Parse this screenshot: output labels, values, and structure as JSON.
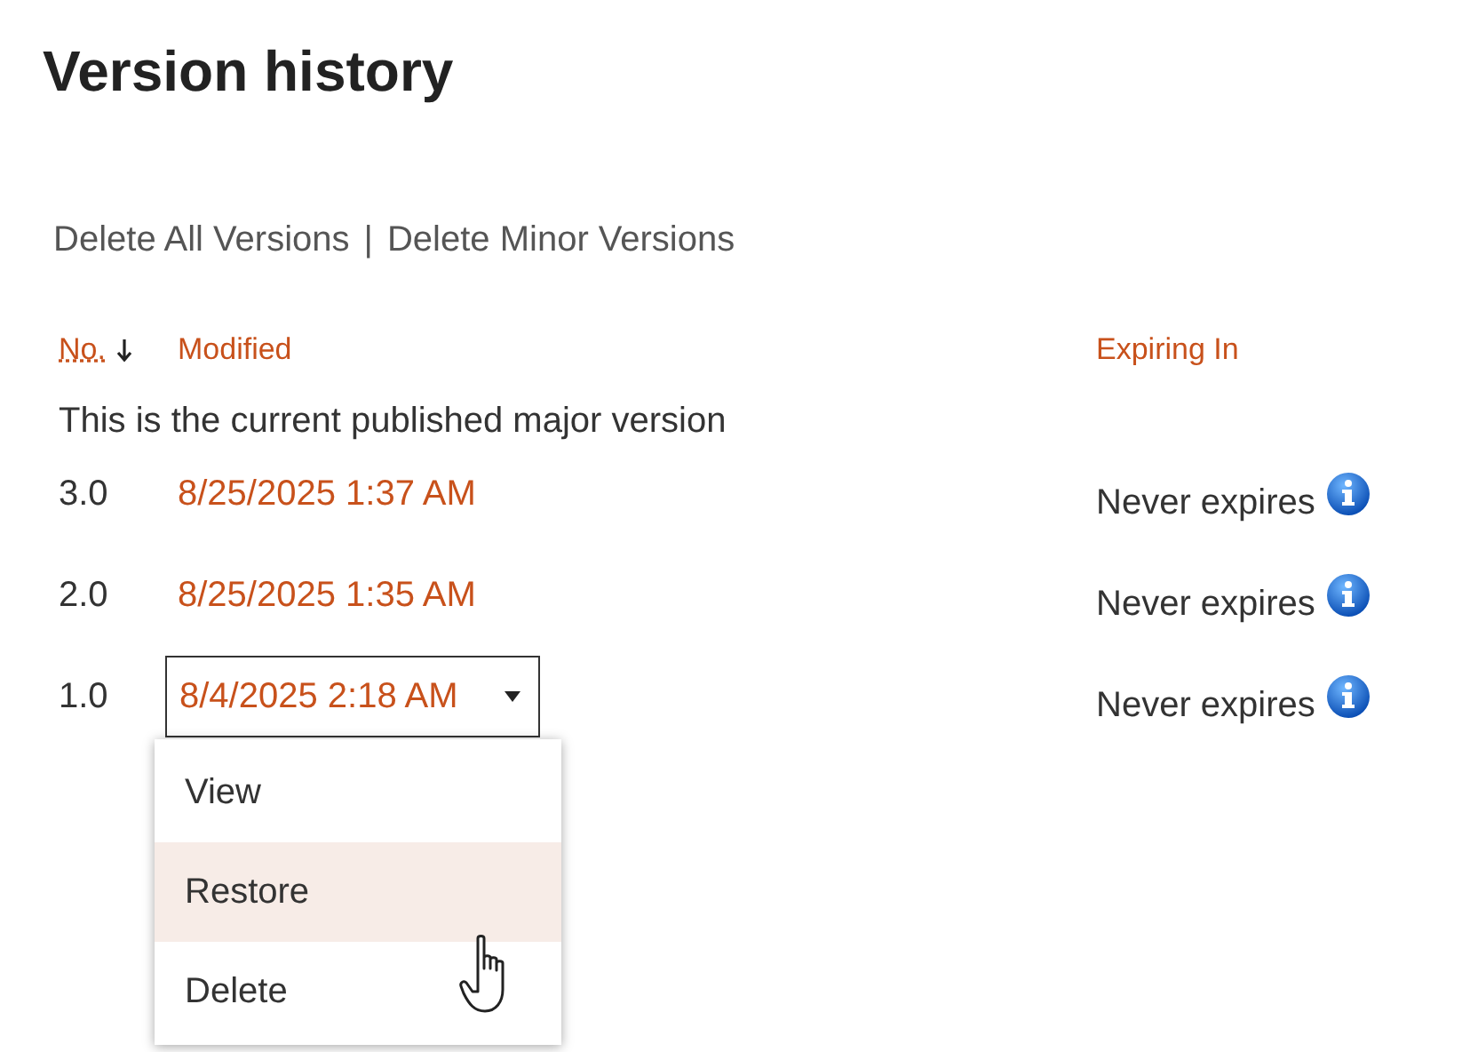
{
  "title": "Version history",
  "actions": [
    {
      "label": "Delete All Versions"
    },
    {
      "label": "Delete Minor Versions"
    }
  ],
  "action_separator": "|",
  "columns": [
    {
      "label": "No.",
      "sorted": true
    },
    {
      "label": "Modified",
      "sorted": false
    },
    {
      "label": "Expiring In",
      "sorted": false
    }
  ],
  "note": "This is the current published major version",
  "rows": [
    {
      "no": "3.0",
      "modified": "8/25/2025 1:37 AM",
      "expiring": "Never expires",
      "menu_open": false
    },
    {
      "no": "2.0",
      "modified": "8/25/2025 1:35 AM",
      "expiring": "Never expires",
      "menu_open": false
    },
    {
      "no": "1.0",
      "modified": "8/4/2025 2:18 AM",
      "expiring": "Never expires",
      "menu_open": true
    }
  ],
  "menu": [
    {
      "label": "View",
      "selected": false
    },
    {
      "label": "Restore",
      "selected": true
    },
    {
      "label": "Delete",
      "selected": false
    }
  ]
}
